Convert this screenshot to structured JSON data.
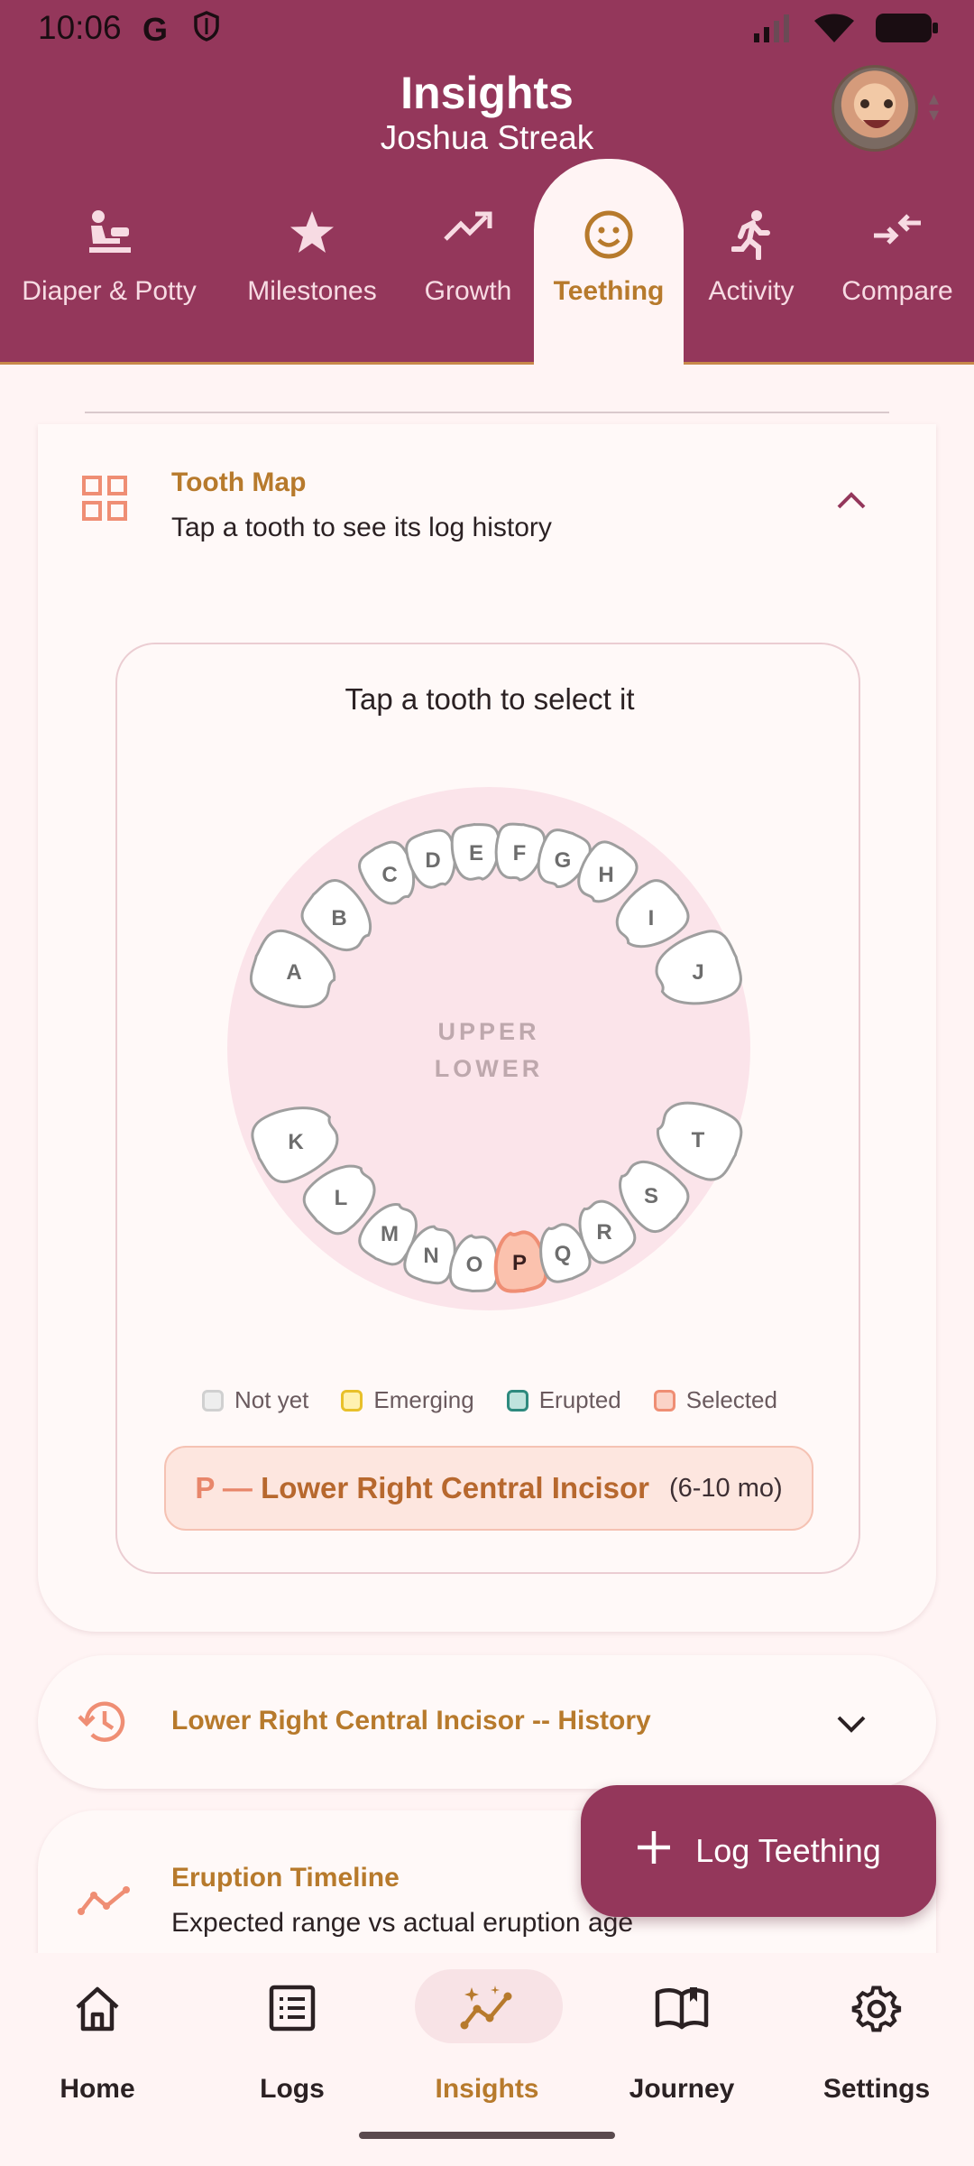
{
  "status_bar": {
    "time": "10:06",
    "g_label": "G"
  },
  "header": {
    "title": "Insights",
    "subtitle": "Joshua Streak"
  },
  "tabs": [
    {
      "label": "Diaper & Potty",
      "icon": "baby-changing-icon"
    },
    {
      "label": "Milestones",
      "icon": "star-icon"
    },
    {
      "label": "Growth",
      "icon": "trending-up-icon"
    },
    {
      "label": "Teething",
      "icon": "smiley-icon",
      "active": true
    },
    {
      "label": "Activity",
      "icon": "running-person-icon"
    },
    {
      "label": "Compare",
      "icon": "compare-arrows-icon"
    }
  ],
  "tooth_map": {
    "title": "Tooth Map",
    "subtitle": "Tap a tooth to see its log history",
    "instruction": "Tap a tooth to select it",
    "upper_label": "UPPER",
    "lower_label": "LOWER",
    "upper_teeth": [
      "A",
      "B",
      "C",
      "D",
      "E",
      "F",
      "G",
      "H",
      "I",
      "J"
    ],
    "lower_teeth": [
      "K",
      "L",
      "M",
      "N",
      "O",
      "P",
      "Q",
      "R",
      "S",
      "T"
    ],
    "selected_tooth": "P",
    "legend": [
      {
        "label": "Not yet",
        "color": "#BDBDBD",
        "fill": "#EEEEEE"
      },
      {
        "label": "Emerging",
        "color": "#E8C02A",
        "fill": "#FFF1B0"
      },
      {
        "label": "Erupted",
        "color": "#2E8A7E",
        "fill": "#BFE3DD"
      },
      {
        "label": "Selected",
        "color": "#EF8E74",
        "fill": "#FBD3C7"
      }
    ],
    "selected": {
      "letter": "P",
      "dash": " — ",
      "name": "Lower Right Central Incisor",
      "range": "(6-10 mo)"
    }
  },
  "history": {
    "title": "Lower Right Central Incisor -- History"
  },
  "timeline": {
    "title": "Eruption Timeline",
    "subtitle": "Expected range vs actual eruption age"
  },
  "fab": {
    "label": "Log Teething"
  },
  "bottom_nav": [
    {
      "label": "Home"
    },
    {
      "label": "Logs"
    },
    {
      "label": "Insights",
      "active": true
    },
    {
      "label": "Journey"
    },
    {
      "label": "Settings"
    }
  ],
  "colors": {
    "brand": "#94375B",
    "accent": "#B77A2C",
    "selected_fill": "#FBD3C7"
  }
}
